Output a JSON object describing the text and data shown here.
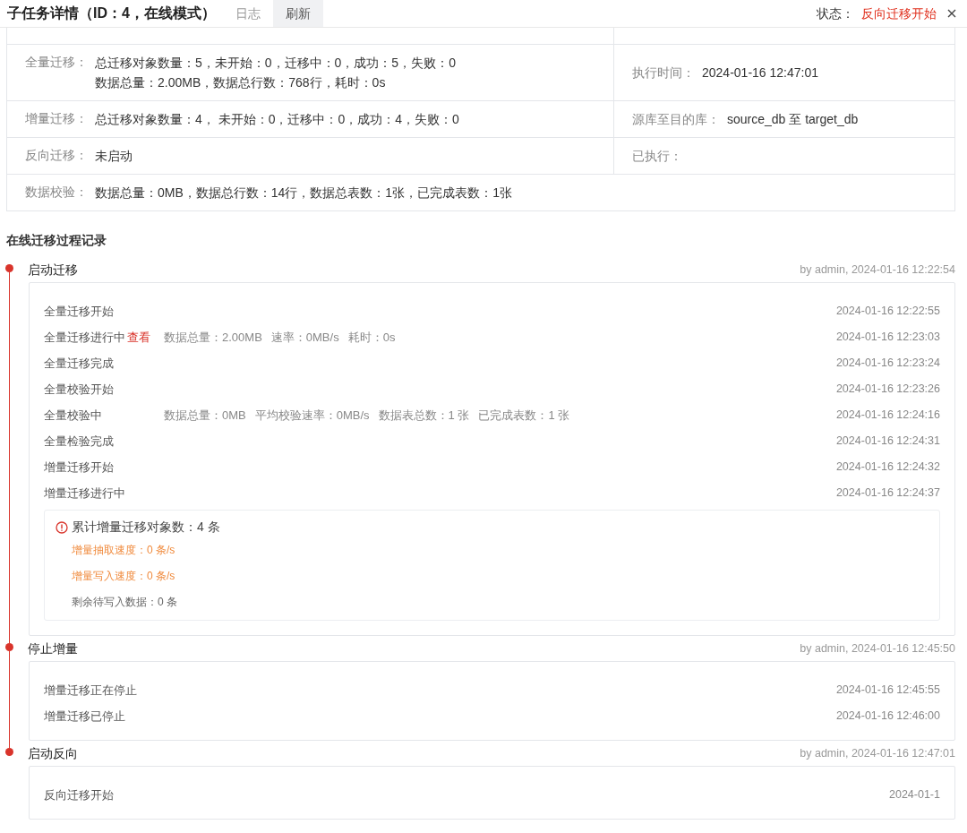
{
  "header": {
    "title": "子任务详情（ID：4，在线模式）",
    "tabs": [
      {
        "label": "日志",
        "selected": false
      },
      {
        "label": "刷新",
        "selected": true
      }
    ],
    "status_label": "状态：",
    "status_value": "反向迁移开始"
  },
  "info_rows": [
    {
      "cells": [
        {
          "label": "全量迁移：",
          "lines": [
            "总迁移对象数量：5，未开始：0，迁移中：0，成功：5，失败：0",
            "数据总量：2.00MB，数据总行数：768行，耗时：0s"
          ]
        },
        {
          "label": "执行时间：",
          "lines": [
            "2024-01-16 12:47:01"
          ]
        }
      ]
    },
    {
      "cells": [
        {
          "label": "增量迁移：",
          "lines": [
            "总迁移对象数量：4， 未开始：0，迁移中：0，成功：4，失败：0"
          ]
        },
        {
          "label": "源库至目的库：",
          "lines": [
            "source_db 至 target_db"
          ]
        }
      ]
    },
    {
      "cells": [
        {
          "label": "反向迁移：",
          "lines": [
            "未启动"
          ]
        },
        {
          "label": "已执行："
        }
      ]
    },
    {
      "cells": [
        {
          "label": "数据校验：",
          "lines": [
            "数据总量：0MB，数据总行数：14行，数据总表数：1张，已完成表数：1张"
          ]
        }
      ]
    }
  ],
  "timeline_title": "在线迁移过程记录",
  "events": [
    {
      "title": "启动迁移",
      "meta": "by admin, 2024-01-16 12:22:54",
      "entries": [
        {
          "text": "全量迁移开始",
          "time": "2024-01-16 12:22:55"
        },
        {
          "text": "全量迁移进行中",
          "link": "查看",
          "details": [
            "数据总量：2.00MB",
            "速率：0MB/s",
            "耗时：0s"
          ],
          "time": "2024-01-16 12:23:03"
        },
        {
          "text": "全量迁移完成",
          "time": "2024-01-16 12:23:24"
        },
        {
          "text": "全量校验开始",
          "time": "2024-01-16 12:23:26"
        },
        {
          "text": "全量校验中",
          "details": [
            "数据总量：0MB",
            "平均校验速率：0MB/s",
            "数据表总数：1 张",
            "已完成表数：1 张"
          ],
          "time": "2024-01-16 12:24:16"
        },
        {
          "text": "全量检验完成",
          "time": "2024-01-16 12:24:31"
        },
        {
          "text": "增量迁移开始",
          "time": "2024-01-16 12:24:32"
        },
        {
          "text": "增量迁移进行中",
          "time": "2024-01-16 12:24:37"
        }
      ],
      "summary": {
        "heading": "累计增量迁移对象数：4 条",
        "lines": [
          {
            "text": "增量抽取速度：0 条/s",
            "kind": "highlight"
          },
          {
            "text": "增量写入速度：0 条/s",
            "kind": "highlight"
          },
          {
            "text": "剩余待写入数据：0 条",
            "kind": "normal"
          }
        ]
      }
    },
    {
      "title": "停止增量",
      "meta": "by admin, 2024-01-16 12:45:50",
      "entries": [
        {
          "text": "增量迁移正在停止",
          "time": "2024-01-16 12:45:55"
        },
        {
          "text": "增量迁移已停止",
          "time": "2024-01-16 12:46:00"
        }
      ]
    },
    {
      "title": "启动反向",
      "meta": "by admin, 2024-01-16 12:47:01",
      "entries": [
        {
          "text": "反向迁移开始",
          "time": "2024-01-1"
        }
      ]
    }
  ]
}
